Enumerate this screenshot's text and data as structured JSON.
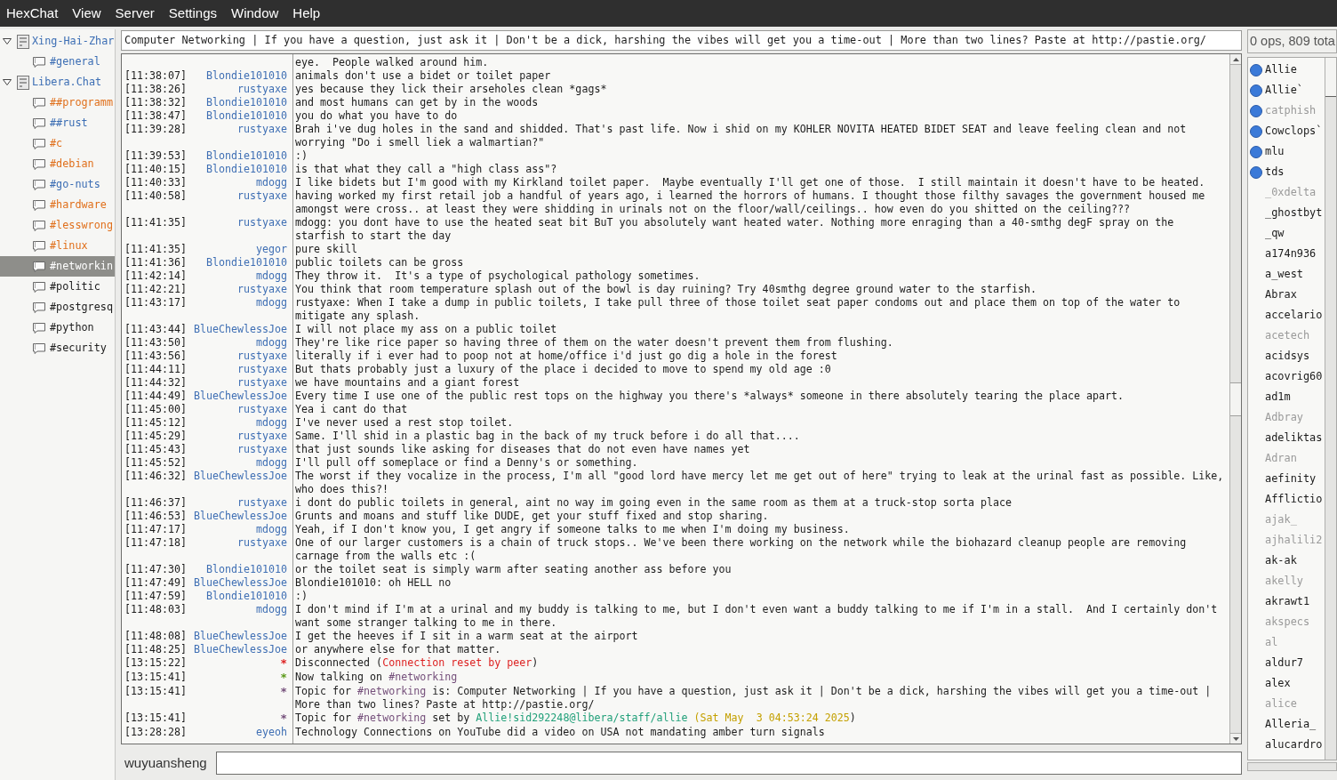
{
  "menu_bar": [
    "HexChat",
    "View",
    "Server",
    "Settings",
    "Window",
    "Help"
  ],
  "channel_tree": [
    {
      "name": "Xing-Hai-Zhar",
      "expanded": true,
      "selected": false,
      "children": [
        {
          "name": "#general",
          "color": "#3c6eb4",
          "selected": false
        }
      ]
    },
    {
      "name": "Libera.Chat",
      "expanded": true,
      "selected": false,
      "children": [
        {
          "name": "##programm",
          "color": "#e0701c",
          "selected": false
        },
        {
          "name": "##rust",
          "color": "#3c6eb4",
          "selected": false
        },
        {
          "name": "#c",
          "color": "#e0701c",
          "selected": false
        },
        {
          "name": "#debian",
          "color": "#e0701c",
          "selected": false
        },
        {
          "name": "#go-nuts",
          "color": "#3c6eb4",
          "selected": false
        },
        {
          "name": "#hardware",
          "color": "#e0701c",
          "selected": false
        },
        {
          "name": "#lesswrong",
          "color": "#e0701c",
          "selected": false
        },
        {
          "name": "#linux",
          "color": "#e0701c",
          "selected": false
        },
        {
          "name": "#networkin",
          "selected": true
        },
        {
          "name": "#politic",
          "color": "#202020",
          "selected": false
        },
        {
          "name": "#postgresq",
          "color": "#202020",
          "selected": false
        },
        {
          "name": "#python",
          "color": "#202020",
          "selected": false
        },
        {
          "name": "#security",
          "color": "#202020",
          "selected": false
        }
      ]
    }
  ],
  "topic": "Computer Networking | If you have a question, just ask it | Don't be a dick, harshing the vibes will get you a time-out | More than two lines? Paste at http://pastie.org/",
  "messages": [
    {
      "kind": "continuation",
      "text": "eye.  People walked around him."
    },
    {
      "kind": "message",
      "time": "[11:38:07]",
      "nick": "Blondie101010",
      "text": "animals don't use a bidet or toilet paper"
    },
    {
      "kind": "message",
      "time": "[11:38:26]",
      "nick": "rustyaxe",
      "text": "yes because they lick their arseholes clean *gags*"
    },
    {
      "kind": "message",
      "time": "[11:38:32]",
      "nick": "Blondie101010",
      "text": "and most humans can get by in the woods"
    },
    {
      "kind": "message",
      "time": "[11:38:47]",
      "nick": "Blondie101010",
      "text": "you do what you have to do"
    },
    {
      "kind": "message",
      "time": "[11:39:28]",
      "nick": "rustyaxe",
      "text": "Brah i've dug holes in the sand and shidded. That's past life. Now i shid on my KOHLER NOVITA HEATED BIDET SEAT and leave feeling clean and not worrying \"Do i smell liek a walmartian?\""
    },
    {
      "kind": "message",
      "time": "[11:39:53]",
      "nick": "Blondie101010",
      "text": ":)"
    },
    {
      "kind": "message",
      "time": "[11:40:15]",
      "nick": "Blondie101010",
      "text": "is that what they call a \"high class ass\"?"
    },
    {
      "kind": "message",
      "time": "[11:40:33]",
      "nick": "mdogg",
      "text": "I like bidets but I'm good with my Kirkland toilet paper.  Maybe eventually I'll get one of those.  I still maintain it doesn't have to be heated."
    },
    {
      "kind": "message",
      "time": "[11:40:58]",
      "nick": "rustyaxe",
      "text": "having worked my first retail job a handful of years ago, i learned the horrors of humans. I thought those filthy savages the government housed me amongst were cross.. at least they were shidding in urinals not on the floor/wall/ceilings.. how even do you shitted on the ceiling???"
    },
    {
      "kind": "message",
      "time": "[11:41:35]",
      "nick": "rustyaxe",
      "text": "mdogg: you dont have to use the heated seat bit BuT you absolutely want heated water. Nothing more enraging than a 40-smthg degF spray on the starfish to start the day"
    },
    {
      "kind": "message",
      "time": "[11:41:35]",
      "nick": "yegor",
      "text": "pure skill"
    },
    {
      "kind": "message",
      "time": "[11:41:36]",
      "nick": "Blondie101010",
      "text": "public toilets can be gross"
    },
    {
      "kind": "message",
      "time": "[11:42:14]",
      "nick": "mdogg",
      "text": "They throw it.  It's a type of psychological pathology sometimes."
    },
    {
      "kind": "message",
      "time": "[11:42:21]",
      "nick": "rustyaxe",
      "text": "You think that room temperature splash out of the bowl is day ruining? Try 40smthg degree ground water to the starfish."
    },
    {
      "kind": "message",
      "time": "[11:43:17]",
      "nick": "mdogg",
      "text": "rustyaxe: When I take a dump in public toilets, I take pull three of those toilet seat paper condoms out and place them on top of the water to mitigate any splash."
    },
    {
      "kind": "message",
      "time": "[11:43:44]",
      "nick": "BlueChewlessJoe",
      "text": "I will not place my ass on a public toilet"
    },
    {
      "kind": "message",
      "time": "[11:43:50]",
      "nick": "mdogg",
      "text": "They're like rice paper so having three of them on the water doesn't prevent them from flushing."
    },
    {
      "kind": "message",
      "time": "[11:43:56]",
      "nick": "rustyaxe",
      "text": "literally if i ever had to poop not at home/office i'd just go dig a hole in the forest"
    },
    {
      "kind": "message",
      "time": "[11:44:11]",
      "nick": "rustyaxe",
      "text": "But thats probably just a luxury of the place i decided to move to spend my old age :0"
    },
    {
      "kind": "message",
      "time": "[11:44:32]",
      "nick": "rustyaxe",
      "text": "we have mountains and a giant forest"
    },
    {
      "kind": "message",
      "time": "[11:44:49]",
      "nick": "BlueChewlessJoe",
      "text": "Every time I use one of the public rest tops on the highway you there's *always* someone in there absolutely tearing the place apart."
    },
    {
      "kind": "message",
      "time": "[11:45:00]",
      "nick": "rustyaxe",
      "text": "Yea i cant do that"
    },
    {
      "kind": "message",
      "time": "[11:45:12]",
      "nick": "mdogg",
      "text": "I've never used a rest stop toilet."
    },
    {
      "kind": "message",
      "time": "[11:45:29]",
      "nick": "rustyaxe",
      "text": "Same. I'll shid in a plastic bag in the back of my truck before i do all that...."
    },
    {
      "kind": "message",
      "time": "[11:45:43]",
      "nick": "rustyaxe",
      "text": "that just sounds like asking for diseases that do not even have names yet"
    },
    {
      "kind": "message",
      "time": "[11:45:52]",
      "nick": "mdogg",
      "text": "I'll pull off someplace or find a Denny's or something."
    },
    {
      "kind": "message",
      "time": "[11:46:32]",
      "nick": "BlueChewlessJoe",
      "text": "The worst if they vocalize in the process, I'm all \"good lord have mercy let me get out of here\" trying to leak at the urinal fast as possible. Like, who does this?!"
    },
    {
      "kind": "message",
      "time": "[11:46:37]",
      "nick": "rustyaxe",
      "text": "i dont do public toilets in general, aint no way im going even in the same room as them at a truck-stop sorta place"
    },
    {
      "kind": "message",
      "time": "[11:46:53]",
      "nick": "BlueChewlessJoe",
      "text": "Grunts and moans and stuff like DUDE, get your stuff fixed and stop sharing."
    },
    {
      "kind": "message",
      "time": "[11:47:17]",
      "nick": "mdogg",
      "text": "Yeah, if I don't know you, I get angry if someone talks to me when I'm doing my business."
    },
    {
      "kind": "message",
      "time": "[11:47:18]",
      "nick": "rustyaxe",
      "text": "One of our larger customers is a chain of truck stops.. We've been there working on the network while the biohazard cleanup people are removing carnage from the walls etc :("
    },
    {
      "kind": "message",
      "time": "[11:47:30]",
      "nick": "Blondie101010",
      "text": "or the toilet seat is simply warm after seating another ass before you"
    },
    {
      "kind": "message",
      "time": "[11:47:49]",
      "nick": "BlueChewlessJoe",
      "text": "Blondie101010: oh HELL no"
    },
    {
      "kind": "message",
      "time": "[11:47:59]",
      "nick": "Blondie101010",
      "text": ":)"
    },
    {
      "kind": "message",
      "time": "[11:48:03]",
      "nick": "mdogg",
      "text": "I don't mind if I'm at a urinal and my buddy is talking to me, but I don't even want a buddy talking to me if I'm in a stall.  And I certainly don't want some stranger talking to me in there."
    },
    {
      "kind": "message",
      "time": "[11:48:08]",
      "nick": "BlueChewlessJoe",
      "text": "I get the heeves if I sit in a warm seat at the airport"
    },
    {
      "kind": "message",
      "time": "[11:48:25]",
      "nick": "BlueChewlessJoe",
      "text": "or anywhere else for that matter."
    },
    {
      "kind": "event",
      "time": "[13:15:22]",
      "nick": "*",
      "color": "#dd2222",
      "segments": [
        {
          "text": "Disconnected ("
        },
        {
          "text": "Connection reset by peer",
          "color": "#dd2222"
        },
        {
          "text": ")"
        }
      ]
    },
    {
      "kind": "event",
      "time": "[13:15:41]",
      "nick": "*",
      "color": "#5c9a1a",
      "segments": [
        {
          "text": "Now talking on "
        },
        {
          "text": "#networking",
          "color": "#75507b"
        }
      ]
    },
    {
      "kind": "event",
      "time": "[13:15:41]",
      "nick": "*",
      "color": "#75507b",
      "segments": [
        {
          "text": "Topic for "
        },
        {
          "text": "#networking",
          "color": "#75507b"
        },
        {
          "text": " is: Computer Networking | If you have a question, just ask it | Don't be a dick, harshing the vibes will get you a time-out | More than two lines? Paste at http://pastie.org/"
        }
      ]
    },
    {
      "kind": "event",
      "time": "[13:15:41]",
      "nick": "*",
      "color": "#75507b",
      "segments": [
        {
          "text": "Topic for "
        },
        {
          "text": "#networking",
          "color": "#75507b"
        },
        {
          "text": " set by "
        },
        {
          "text": "Allie!sid292248@libera/staff/allie",
          "color": "#22a07a"
        },
        {
          "text": " (Sat May  3 04:53:24 2025",
          "color": "#c4a000"
        },
        {
          "text": ")"
        }
      ]
    },
    {
      "kind": "message",
      "time": "[13:28:28]",
      "nick": "eyeoh",
      "text": "Technology Connections on YouTube did a video on USA not mandating amber turn signals"
    }
  ],
  "input": {
    "nick": "wuyuansheng"
  },
  "user_list": {
    "summary": "0 ops, 809 tota",
    "users": [
      {
        "name": "Allie",
        "voiced": true,
        "away": false
      },
      {
        "name": "Allie`",
        "voiced": true,
        "away": false
      },
      {
        "name": "catphish",
        "voiced": true,
        "away": true
      },
      {
        "name": "Cowclops`",
        "voiced": true,
        "away": false
      },
      {
        "name": "mlu",
        "voiced": true,
        "away": false
      },
      {
        "name": "tds",
        "voiced": true,
        "away": false
      },
      {
        "name": "_0xdelta",
        "voiced": false,
        "away": true
      },
      {
        "name": "_ghostbyt",
        "voiced": false,
        "away": false
      },
      {
        "name": "_qw",
        "voiced": false,
        "away": false
      },
      {
        "name": "a174n936",
        "voiced": false,
        "away": false
      },
      {
        "name": "a_west",
        "voiced": false,
        "away": false
      },
      {
        "name": "Abrax",
        "voiced": false,
        "away": false
      },
      {
        "name": "accelario",
        "voiced": false,
        "away": false
      },
      {
        "name": "acetech",
        "voiced": false,
        "away": true
      },
      {
        "name": "acidsys",
        "voiced": false,
        "away": false
      },
      {
        "name": "acovrig60",
        "voiced": false,
        "away": false
      },
      {
        "name": "ad1m",
        "voiced": false,
        "away": false
      },
      {
        "name": "Adbray",
        "voiced": false,
        "away": true
      },
      {
        "name": "adeliktas",
        "voiced": false,
        "away": false
      },
      {
        "name": "Adran",
        "voiced": false,
        "away": true
      },
      {
        "name": "aefinity",
        "voiced": false,
        "away": false
      },
      {
        "name": "Afflictio",
        "voiced": false,
        "away": false
      },
      {
        "name": "ajak_",
        "voiced": false,
        "away": true
      },
      {
        "name": "ajhalili2",
        "voiced": false,
        "away": true
      },
      {
        "name": "ak-ak",
        "voiced": false,
        "away": false
      },
      {
        "name": "akelly",
        "voiced": false,
        "away": true
      },
      {
        "name": "akrawt1",
        "voiced": false,
        "away": false
      },
      {
        "name": "akspecs",
        "voiced": false,
        "away": true
      },
      {
        "name": "al",
        "voiced": false,
        "away": true
      },
      {
        "name": "aldur7",
        "voiced": false,
        "away": false
      },
      {
        "name": "alex",
        "voiced": false,
        "away": false
      },
      {
        "name": "alice",
        "voiced": false,
        "away": true
      },
      {
        "name": "Alleria_",
        "voiced": false,
        "away": false
      },
      {
        "name": "alucardro",
        "voiced": false,
        "away": false
      }
    ]
  }
}
